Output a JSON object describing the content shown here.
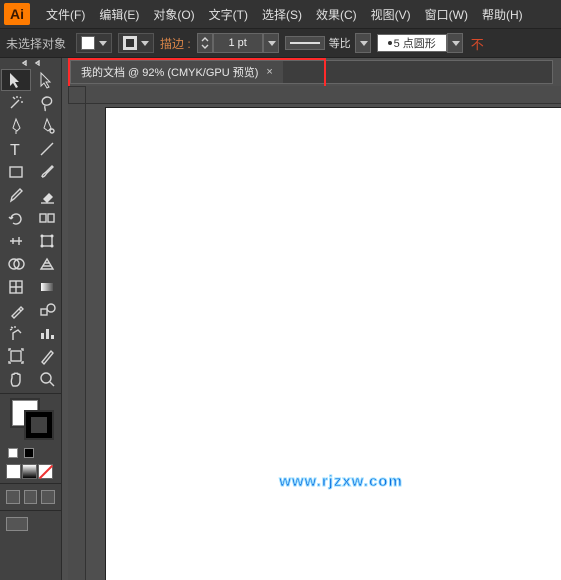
{
  "app": {
    "logo": "Ai"
  },
  "menu": {
    "file": "文件(F)",
    "edit": "编辑(E)",
    "object": "对象(O)",
    "type": "文字(T)",
    "select": "选择(S)",
    "effect": "效果(C)",
    "view": "视图(V)",
    "window": "窗口(W)",
    "help": "帮助(H)"
  },
  "options": {
    "noselection": "未选择对象",
    "stroke_label": "描边 :",
    "stroke_weight": "1 pt",
    "ratio_label": "等比",
    "brush_label": "5 点圆形",
    "edge_cut": "不"
  },
  "document": {
    "tab_title": "我的文档 @ 92% (CMYK/GPU 预览)",
    "close": "×"
  },
  "watermark": "www.rjzxw.com",
  "tools": {
    "selection": "selection",
    "direct": "direct-selection",
    "wand": "magic-wand",
    "lasso": "lasso",
    "pen": "pen",
    "curvature": "curvature",
    "type": "type",
    "line": "line-segment",
    "rect": "rectangle",
    "brush": "paintbrush",
    "pencil": "pencil",
    "eraser": "eraser",
    "rotate": "rotate",
    "scale": "reflect",
    "width": "width",
    "warp": "free-transform",
    "shapebuilder": "shape-builder",
    "perspective": "perspective-grid",
    "mesh": "mesh",
    "gradient": "gradient",
    "eyedrop": "eyedropper",
    "blend": "blend",
    "symbol": "symbol-sprayer",
    "graph": "column-graph",
    "artboard": "artboard",
    "slice": "slice",
    "hand": "hand",
    "zoom": "zoom"
  }
}
